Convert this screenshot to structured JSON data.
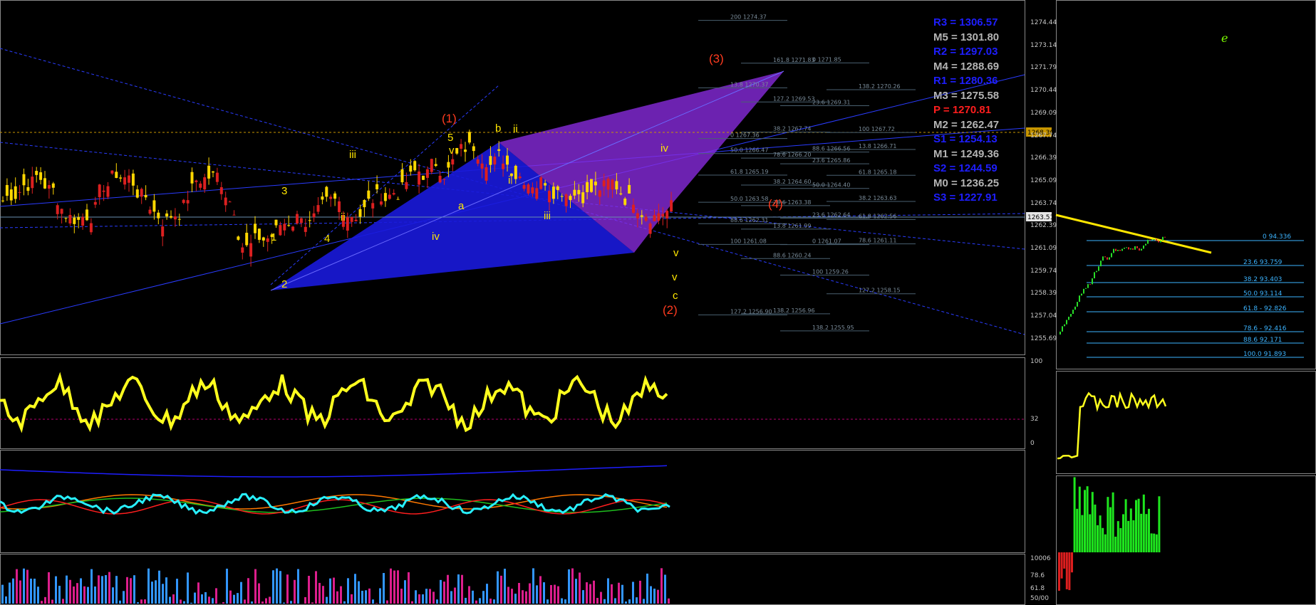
{
  "chart_data": [
    {
      "type": "candlestick",
      "panel": "main-price",
      "price_axis_ticks": [
        "1274.44",
        "1273.14",
        "1271.79",
        "1270.44",
        "1269.09",
        "1267.74",
        "1266.39",
        "1265.09",
        "1263.74",
        "1262.39",
        "1261.09",
        "1259.74",
        "1258.39",
        "1257.04",
        "1255.69"
      ],
      "current_price_label": "1263.51",
      "marked_level_label": "1268.30",
      "ylim": [
        1255.69,
        1274.44
      ],
      "pivot_levels": [
        {
          "label": "R3 = 1306.57",
          "color": "#1e1eff"
        },
        {
          "label": "M5 = 1301.80",
          "color": "#b4b4b4"
        },
        {
          "label": "R2 = 1297.03",
          "color": "#1e1eff"
        },
        {
          "label": "M4 = 1288.69",
          "color": "#b4b4b4"
        },
        {
          "label": "R1 = 1280.36",
          "color": "#1e1eff"
        },
        {
          "label": "M3 = 1275.58",
          "color": "#b4b4b4"
        },
        {
          "label": "P  = 1270.81",
          "color": "#ff1e1e"
        },
        {
          "label": "M2 = 1262.47",
          "color": "#b4b4b4"
        },
        {
          "label": "S1 = 1254.13",
          "color": "#1e1eff"
        },
        {
          "label": "M1 = 1249.36",
          "color": "#b4b4b4"
        },
        {
          "label": "S2 = 1244.59",
          "color": "#1e1eff"
        },
        {
          "label": "M0 = 1236.25",
          "color": "#b4b4b4"
        },
        {
          "label": "S3 = 1227.91",
          "color": "#1e1eff"
        }
      ],
      "fib_labels": [
        "200 1274.37",
        "161.8 1271.83",
        "0 1271.85",
        "138.2 1270.26",
        "13.8 1270.37",
        "127.2 1269.53",
        "23.6 1269.31",
        "100 1267.72",
        "0 1267.36",
        "38.2 1267.74",
        "88.6 1266.56",
        "13.8 1266.71",
        "50.0 1266.47",
        "78.6 1266.20",
        "23.6 1265.86",
        "61.8 1265.18",
        "61.8 1265.19",
        "38.2 1264.60",
        "50.0 1264.40",
        "38.2 1263.63",
        "50.0 1263.58",
        "78.6 1263.38",
        "23.6 1262.64",
        "61.8 1262.56",
        "88.6 1262.31",
        "13.8 1261.99",
        "0 1261.07",
        "78.6 1261.11",
        "100 1261.08",
        "88.6 1260.24",
        "100 1259.26",
        "127.2 1258.15",
        "127.2 1256.90",
        "138.2 1256.96",
        "138.2 1255.95"
      ],
      "wave_labels_red": [
        "(1)",
        "(3)",
        "(4)",
        "(2)"
      ],
      "wave_labels_yellow": [
        "5",
        "b",
        "ii",
        "iii",
        "3",
        "1",
        "2",
        "4",
        "a",
        "i",
        "iii",
        "iv",
        "iv",
        "v",
        "c",
        "v",
        "ii",
        "v"
      ]
    },
    {
      "type": "line",
      "panel": "oscillator-1",
      "axis_ticks": [
        "100",
        "32",
        "0"
      ],
      "reference_level": 32
    },
    {
      "type": "line",
      "panel": "oscillator-2"
    },
    {
      "type": "bar",
      "panel": "oscillator-3",
      "axis_ticks": [
        "10006",
        "78.6",
        "61.8",
        "50/00"
      ]
    },
    {
      "type": "candlestick",
      "panel": "side-chart",
      "top_label": "0 94.336",
      "fib_labels": [
        "23.6 93.759",
        "38.2 93.403",
        "50.0 93.114",
        "61.8 - 92.826",
        "78.6 - 92.416",
        "88.6 92.171",
        "100.0 91.893"
      ]
    }
  ],
  "corner_glyph": "e",
  "colors": {
    "background": "#000000",
    "bull": "#ffd700",
    "bear": "#dc2020",
    "wave_red": "#ff3b1f",
    "wave_yellow": "#ffe600",
    "pattern_blue": "#1a1adc",
    "pattern_purple": "#8a2be2",
    "osc_yellow": "#ffff1e",
    "osc_cyan": "#28f0ff",
    "side_fib": "#3cb4ff"
  }
}
